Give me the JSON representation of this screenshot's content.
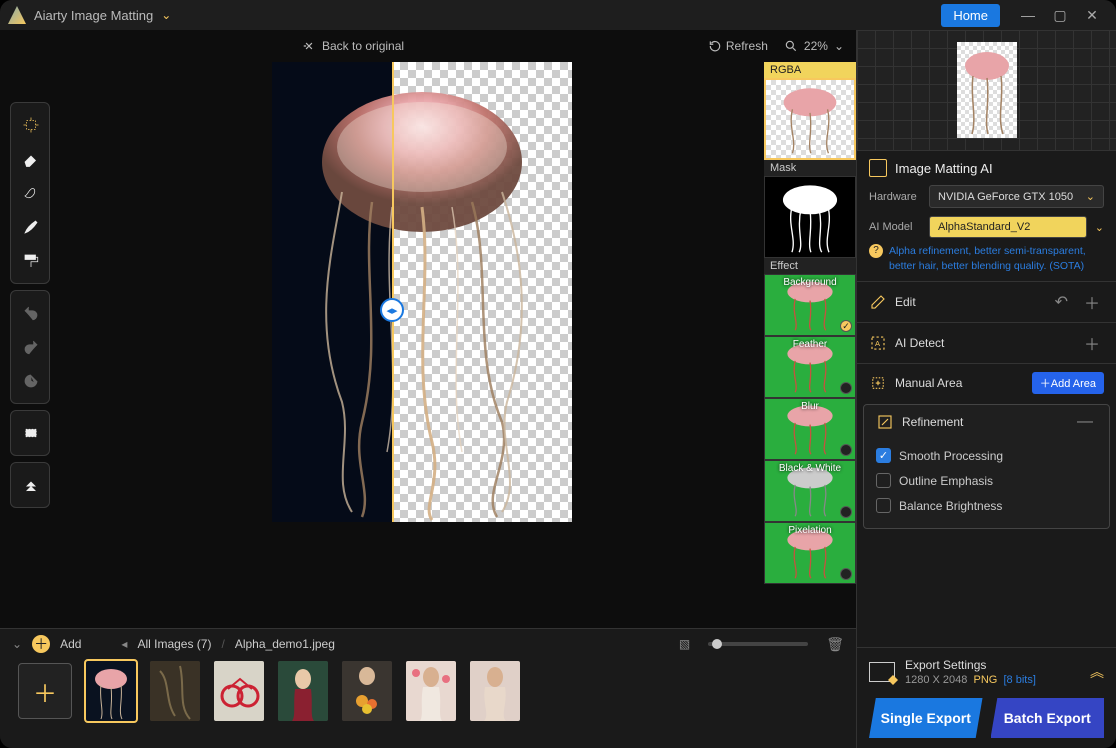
{
  "titlebar": {
    "app_name": "Aiarty Image Matting",
    "home": "Home"
  },
  "canvasbar": {
    "back": "Back to original",
    "refresh": "Refresh",
    "zoom": "22%"
  },
  "tools": {
    "move": "move-tool",
    "eraser": "eraser-tool",
    "matte": "matte-tool",
    "brush": "brush-tool",
    "roller": "roller-tool",
    "undo": "undo",
    "redo": "redo",
    "history": "history",
    "rect": "rect-tool",
    "collapse": "collapse"
  },
  "previews": {
    "rgba": "RGBA",
    "mask": "Mask",
    "effect": "Effect",
    "effects": [
      {
        "name": "Background",
        "checked": true
      },
      {
        "name": "Feather",
        "checked": false
      },
      {
        "name": "Blur",
        "checked": false
      },
      {
        "name": "Black & White",
        "checked": false
      },
      {
        "name": "Pixelation",
        "checked": false
      }
    ]
  },
  "sidebar": {
    "matting_title": "Image Matting AI",
    "hw_label": "Hardware",
    "hw_value": "NVIDIA GeForce GTX 1050",
    "model_label": "AI Model",
    "model_value": "AlphaStandard_V2",
    "model_desc": "Alpha refinement, better semi-transparent, better hair, better blending quality. (SOTA)",
    "edit": "Edit",
    "aidetect": "AI Detect",
    "manual": "Manual Area",
    "add_area": "Add Area",
    "refine": "Refinement",
    "checks": {
      "smooth": "Smooth Processing",
      "outline": "Outline Emphasis",
      "balance": "Balance Brightness"
    }
  },
  "export": {
    "title": "Export Settings",
    "size": "1280 X 2048",
    "format": "PNG",
    "bits": "[8 bits]",
    "single": "Single Export",
    "batch": "Batch Export"
  },
  "filmstrip": {
    "add": "Add",
    "all": "All Images (7)",
    "sep": "/",
    "current": "Alpha_demo1.jpeg"
  }
}
